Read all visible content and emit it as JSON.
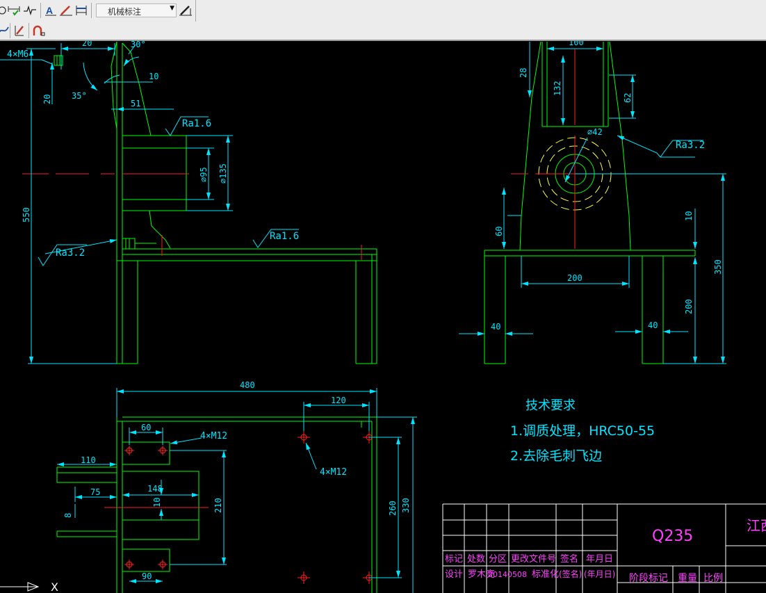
{
  "toolbar": {
    "style_combo_value": "机械标注"
  },
  "icons": [
    "circle-icon",
    "dim-check-icon",
    "break-line-icon",
    "text-style-icon",
    "leader-pen-icon",
    "dim-style-icon",
    "pen-edit-icon",
    "curve-icon",
    "slash-edit-icon",
    "arc-icon"
  ],
  "colors": {
    "background": "#000000",
    "geometry": "#00ff00",
    "dimension": "#00e5ff",
    "centerline": "#ff2020",
    "hidden": "#ffff40",
    "title_text": "#ff40ff",
    "table_lines": "#ffffff"
  },
  "side_view": {
    "dims": {
      "thread_top": "4×M6",
      "w20": "20",
      "a30": "30°",
      "a35": "35°",
      "h20": "20",
      "w10": "10",
      "w51": "51",
      "h550": "550",
      "d95": "⌀95",
      "d135": "⌀135"
    },
    "roughness": {
      "hole": "Ra1.6",
      "left": "Ra3.2",
      "top": "Ra1.6"
    }
  },
  "front_view": {
    "dims": {
      "w100": "100",
      "h28": "28",
      "h132": "132",
      "h62": "62",
      "d42": "⌀42",
      "h10": "10",
      "h60": "60",
      "w200": "200",
      "h350": "350",
      "h200": "200",
      "w40a": "40",
      "w40b": "40"
    },
    "roughness": "Ra3.2"
  },
  "top_view": {
    "dims": {
      "w480": "480",
      "w120": "120",
      "w60": "60",
      "thread_a": "4×M12",
      "thread_b": "4×M12",
      "w110": "110",
      "w75": "75",
      "w148": "148",
      "h10": "10",
      "h8": "8",
      "h210": "210",
      "h260": "260",
      "h330": "330",
      "w90": "90"
    }
  },
  "tech": {
    "title": "技术要求",
    "line1": "1.调质处理，HRC50-55",
    "line2": "2.去除毛刺飞边"
  },
  "title_block": {
    "material": "Q235",
    "company_partial": "江西",
    "row1": [
      "标记",
      "处数",
      "分区",
      "更改文件号",
      "签名",
      "年月日"
    ],
    "row2": [
      "设计",
      "罗木亮",
      "20140508",
      "标准化",
      "(签名)",
      "(年月日)"
    ],
    "stage_labels": [
      "阶段标记",
      "重量",
      "比例"
    ]
  },
  "ucs": {
    "x_label": "X"
  }
}
